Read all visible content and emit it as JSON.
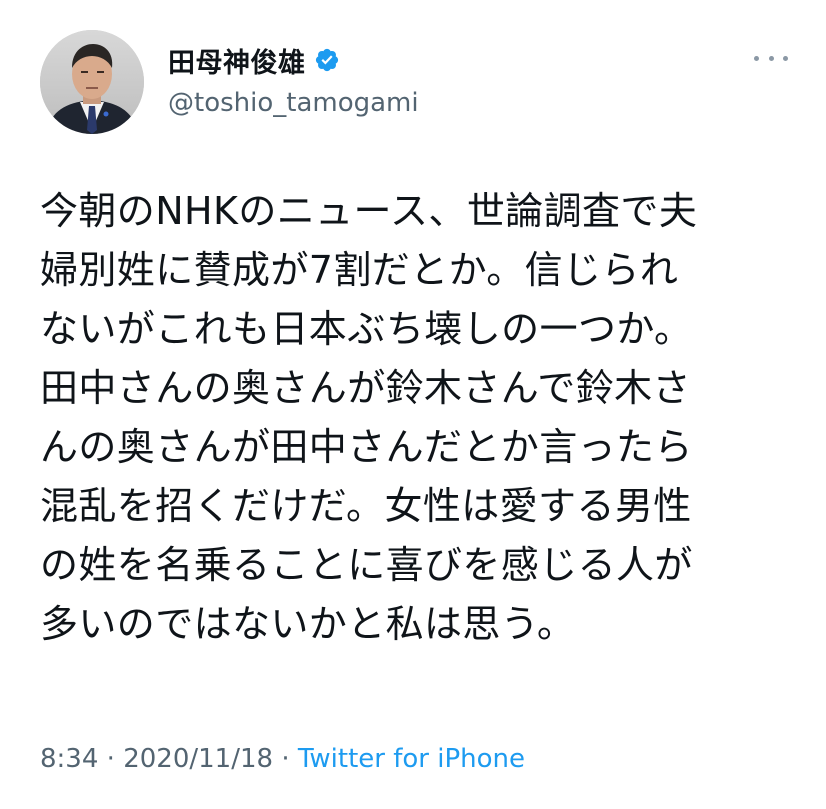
{
  "author": {
    "display_name": "田母神俊雄",
    "handle": "@toshio_tamogami",
    "verified": true,
    "avatar_icon": "profile-photo"
  },
  "menu": {
    "icon": "more-horizontal-icon"
  },
  "tweet": {
    "lines": [
      "今朝のNHKのニュース、世論調査で夫",
      "婦別姓に賛成が7割だとか。信じられ",
      "ないがこれも日本ぶち壊しの一つか。",
      "田中さんの奥さんが鈴木さんで鈴木さ",
      "んの奥さんが田中さんだとか言ったら",
      "混乱を招くだけだ。女性は愛する男性",
      "の姓を名乗ることに喜びを感じる人が",
      "多いのではないかと私は思う。"
    ]
  },
  "meta": {
    "time": "8:34",
    "sep1": "·",
    "date": "2020/11/18",
    "sep2": "·",
    "source": "Twitter for iPhone"
  },
  "colors": {
    "text": "#0f1419",
    "secondary": "#536471",
    "link": "#1d9bf0",
    "verified": "#1d9bf0"
  }
}
